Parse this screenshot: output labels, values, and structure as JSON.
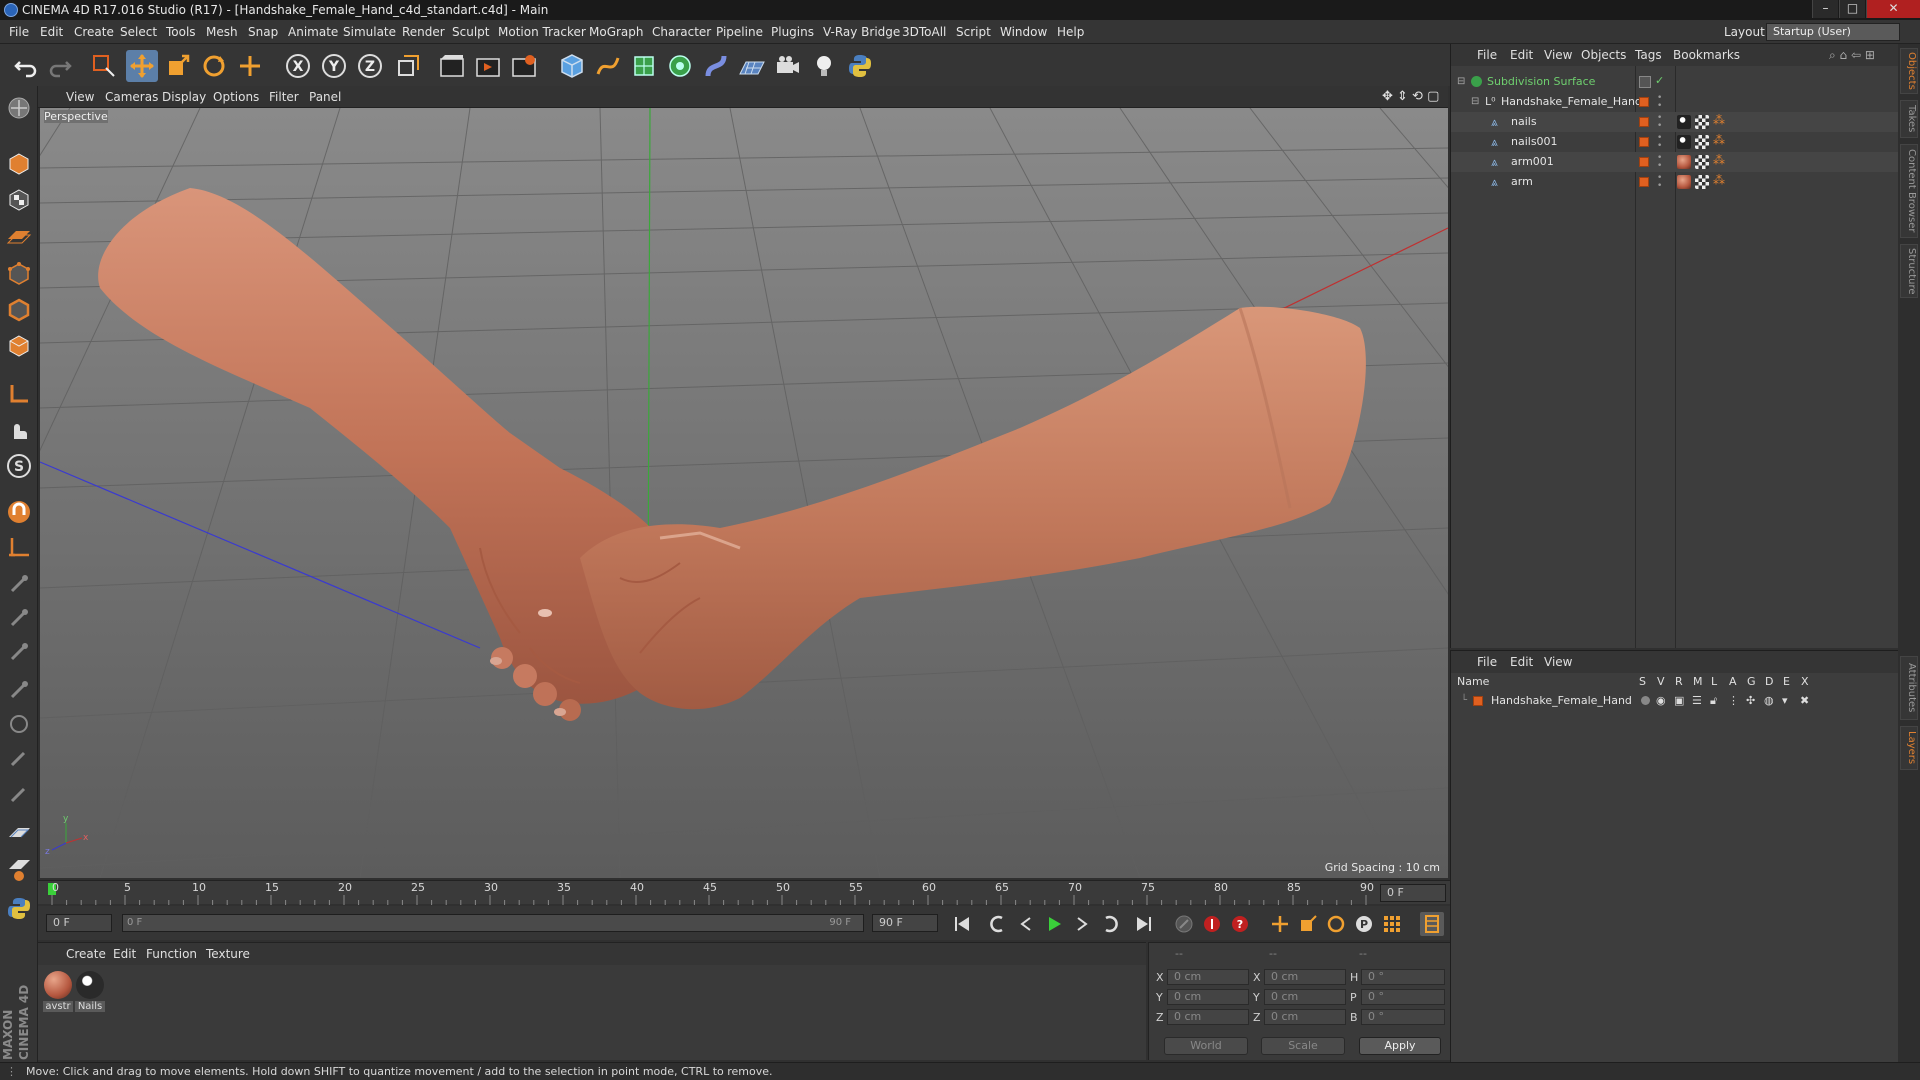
{
  "window": {
    "title": "CINEMA 4D R17.016 Studio (R17) - [Handshake_Female_Hand_c4d_standart.c4d] - Main"
  },
  "menubar": {
    "items": [
      "File",
      "Edit",
      "Create",
      "Select",
      "Tools",
      "Mesh",
      "Snap",
      "Animate",
      "Simulate",
      "Render",
      "Sculpt",
      "Motion Tracker",
      "MoGraph",
      "Character",
      "Pipeline",
      "Plugins",
      "V-Ray Bridge",
      "3DToAll",
      "Script",
      "Window",
      "Help"
    ],
    "layout_label": "Layout:",
    "layout_value": "Startup (User)"
  },
  "viewport": {
    "menu": [
      "View",
      "Cameras",
      "Display",
      "Options",
      "Filter",
      "Panel"
    ],
    "camera_label": "Perspective",
    "grid_spacing": "Grid Spacing : 10 cm"
  },
  "timeline": {
    "ticks": [
      "0",
      "5",
      "10",
      "15",
      "20",
      "25",
      "30",
      "35",
      "40",
      "45",
      "50",
      "55",
      "60",
      "65",
      "70",
      "75",
      "80",
      "85",
      "90"
    ],
    "current_frame": "0 F",
    "start_frame": "0 F",
    "range_start": "0 F",
    "range_end": "90 F",
    "end_frame": "90 F"
  },
  "material_manager": {
    "menu": [
      "Create",
      "Edit",
      "Function",
      "Texture"
    ],
    "materials": [
      {
        "name": "avstr",
        "color": "#b5573f"
      },
      {
        "name": "Nails",
        "color": "#2a2a2a"
      }
    ]
  },
  "coordinates": {
    "headers": [
      "--",
      "--",
      "--"
    ],
    "rows": [
      {
        "a": "X",
        "av": "0 cm",
        "b": "X",
        "bv": "0 cm",
        "c": "H",
        "cv": "0 °"
      },
      {
        "a": "Y",
        "av": "0 cm",
        "b": "Y",
        "bv": "0 cm",
        "c": "P",
        "cv": "0 °"
      },
      {
        "a": "Z",
        "av": "0 cm",
        "b": "Z",
        "bv": "0 cm",
        "c": "B",
        "cv": "0 °"
      }
    ],
    "mode_world": "World",
    "mode_scale": "Scale",
    "apply": "Apply"
  },
  "object_manager": {
    "menu": [
      "File",
      "Edit",
      "View",
      "Objects",
      "Tags",
      "Bookmarks"
    ],
    "objects": [
      {
        "name": "Subdivision Surface",
        "depth": 0,
        "color": "#6fcf6f"
      },
      {
        "name": "Handshake_Female_Hand",
        "depth": 1,
        "color": "#e4e4e4"
      },
      {
        "name": "nails",
        "depth": 2,
        "color": "#e4e4e4"
      },
      {
        "name": "nails001",
        "depth": 2,
        "color": "#e4e4e4"
      },
      {
        "name": "arm001",
        "depth": 2,
        "color": "#e4e4e4"
      },
      {
        "name": "arm",
        "depth": 2,
        "color": "#e4e4e4"
      }
    ]
  },
  "layer_manager": {
    "menu": [
      "File",
      "Edit",
      "View"
    ],
    "columns": [
      "Name",
      "S",
      "V",
      "R",
      "M",
      "L",
      "A",
      "G",
      "D",
      "E",
      "X"
    ],
    "layers": [
      {
        "name": "Handshake_Female_Hand"
      }
    ]
  },
  "side_tabs": [
    "Objects",
    "Takes",
    "Content Browser",
    "Structure",
    "Attributes",
    "Layers"
  ],
  "status": {
    "text": "Move: Click and drag to move elements. Hold down SHIFT to quantize movement / add to the selection in point mode, CTRL to remove."
  },
  "branding": {
    "logo": "MAXON CINEMA 4D"
  },
  "colors": {
    "accent": "#e06020",
    "viewport_bg": "#6d6d6d",
    "panel_bg": "#3d3d3d"
  }
}
